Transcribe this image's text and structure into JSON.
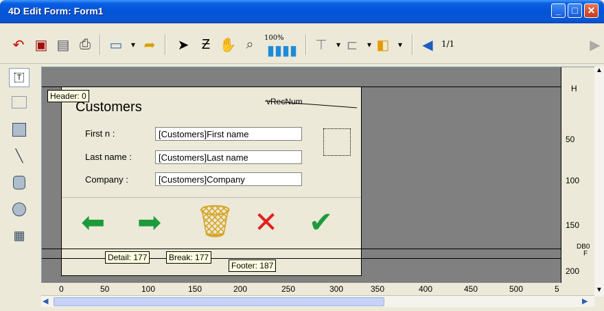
{
  "window": {
    "title": "4D Edit Form: Form1"
  },
  "toolbar": {
    "page_indicator": "1/1",
    "zoom_label": "100%"
  },
  "markers": {
    "header": "Header: 0",
    "detail": "Detail: 177",
    "break": "Break: 177",
    "footer": "Footer: 187"
  },
  "form": {
    "title": "Customers",
    "record_label": "vRecNum",
    "fields": [
      {
        "label": "First n :",
        "value": "[Customers]First name"
      },
      {
        "label": "Last name :",
        "value": "[Customers]Last name"
      },
      {
        "label": "Company :",
        "value": "[Customers]Company"
      }
    ]
  },
  "ruler_vertical": {
    "top_marker": "H",
    "ticks": [
      "50",
      "100",
      "150",
      "200"
    ],
    "side_marker_a": "DB0",
    "side_marker_b": "F"
  },
  "ruler_horizontal": {
    "ticks": [
      "0",
      "50",
      "100",
      "150",
      "200",
      "250",
      "300",
      "350",
      "400",
      "450",
      "500",
      "5"
    ]
  },
  "colors": {
    "titlebar": "#0353d8",
    "canvas": "#808080",
    "form_bg": "#ece9d8"
  }
}
